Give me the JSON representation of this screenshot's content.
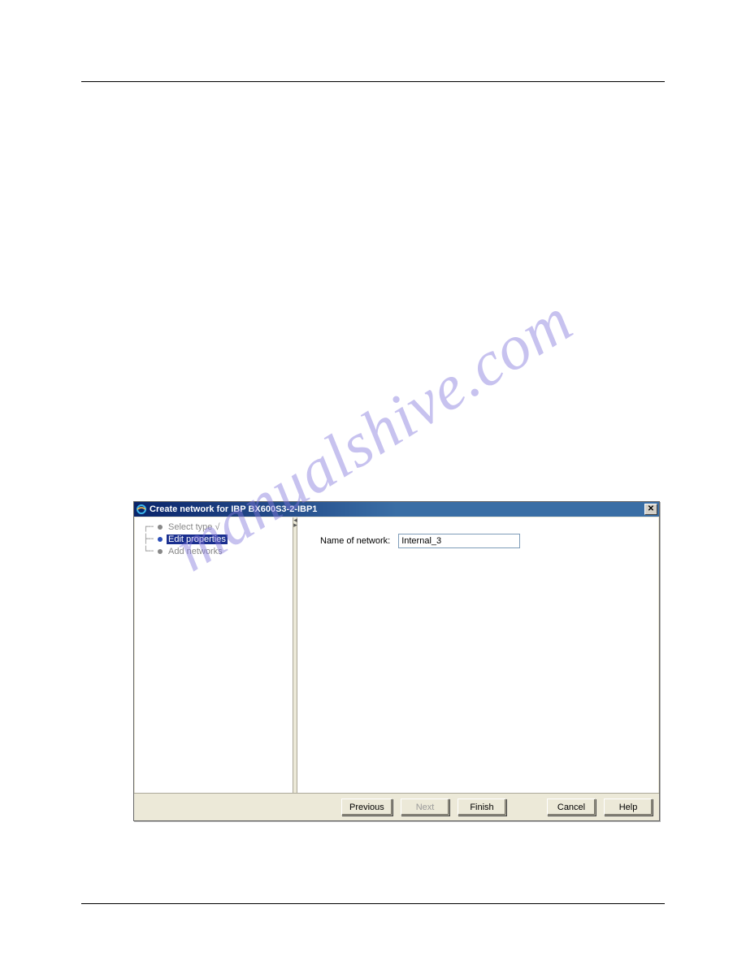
{
  "watermark": "manualshive.com",
  "dialog": {
    "title": "Create network for IBP BX600S3-2-IBP1",
    "tree": {
      "items": [
        {
          "label": "Select type √",
          "selected": false
        },
        {
          "label": "Edit properties",
          "selected": true
        },
        {
          "label": "Add networks",
          "selected": false
        }
      ]
    },
    "form": {
      "network_label": "Name of network:",
      "network_value": "Internal_3"
    },
    "buttons": {
      "previous": "Previous",
      "next": "Next",
      "finish": "Finish",
      "cancel": "Cancel",
      "help": "Help"
    }
  }
}
